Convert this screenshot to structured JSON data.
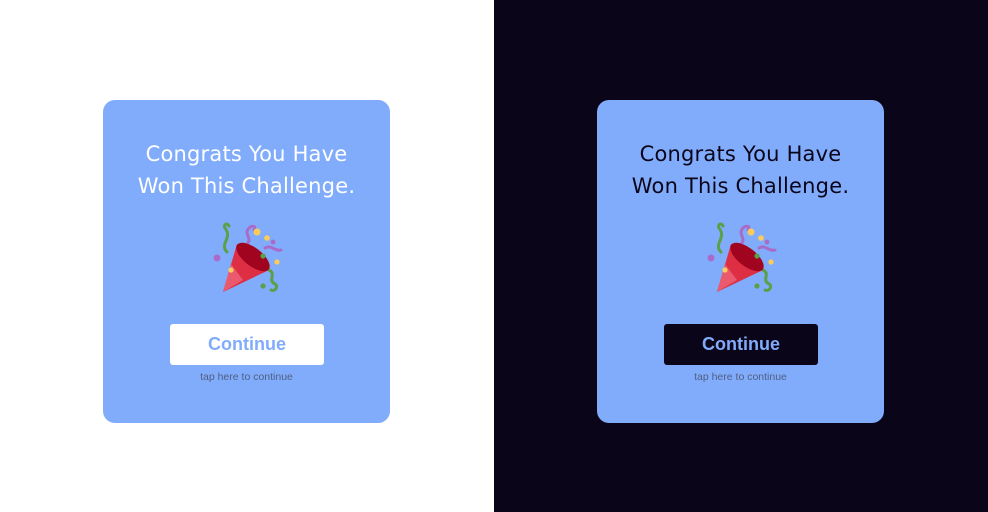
{
  "variants": [
    {
      "theme": "light",
      "title_line1": "Congrats You Have",
      "title_line2": "Won This Challenge.",
      "icon": "party-popper-icon",
      "button_label": "Continue",
      "hint": "tap here to continue"
    },
    {
      "theme": "dark",
      "title_line1": "Congrats You Have",
      "title_line2": "Won This Challenge.",
      "icon": "party-popper-icon",
      "button_label": "Continue",
      "hint": "tap here to continue"
    }
  ],
  "colors": {
    "card": "#81acfc",
    "light_background": "#ffffff",
    "dark_background": "#0b0519",
    "button_text": "#81acfc",
    "hint_text": "#4f5f82"
  }
}
